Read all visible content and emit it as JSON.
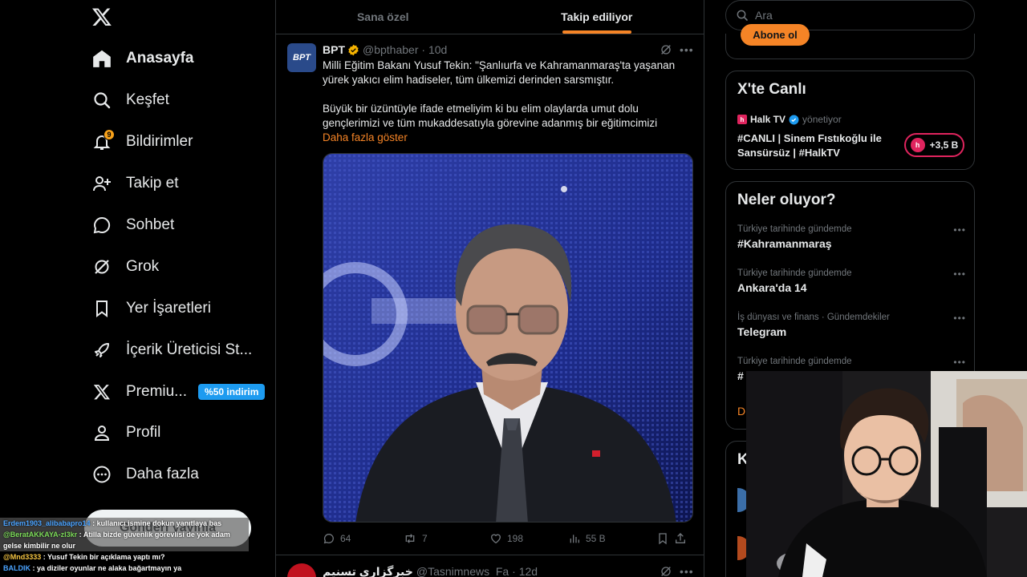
{
  "sidebar": {
    "items": [
      {
        "label": "Anasayfa",
        "icon": "home-icon"
      },
      {
        "label": "Keşfet",
        "icon": "search-icon"
      },
      {
        "label": "Bildirimler",
        "icon": "bell-icon",
        "badge": "9"
      },
      {
        "label": "Takip et",
        "icon": "follow-icon"
      },
      {
        "label": "Sohbet",
        "icon": "chat-icon"
      },
      {
        "label": "Grok",
        "icon": "grok-icon"
      },
      {
        "label": "Yer İşaretleri",
        "icon": "bookmark-icon"
      },
      {
        "label": "İçerik Üreticisi St...",
        "icon": "rocket-icon"
      },
      {
        "label": "Premiu...",
        "icon": "x-icon",
        "promo": "%50 indirim"
      },
      {
        "label": "Profil",
        "icon": "person-icon"
      },
      {
        "label": "Daha fazla",
        "icon": "more-circle-icon"
      }
    ],
    "post_button": "Gönderi yayınla"
  },
  "chat": [
    {
      "user": "Erdem1903_alibabapro14",
      "text": "kullanıcı ismine dokun yanıtlaya bas",
      "user_color": "#4aa3ff"
    },
    {
      "user": "@BeratAKKAYA-zl3kr",
      "text": "Atilla bizde güvenlik görevlisi de yok adam gelse kimbilir ne olur",
      "user_color": "#7ddc5a"
    },
    {
      "user": "@Mnd3333",
      "text": "Yusuf Tekin bir açıklama yaptı mı?",
      "user_color": "#f5c542"
    },
    {
      "user": "BALDIK",
      "text": "ya diziler oyunlar ne alaka bağartmayın ya",
      "user_color": "#4aa3ff"
    }
  ],
  "tabs": {
    "for_you": "Sana özel",
    "following": "Takip ediliyor"
  },
  "tweet": {
    "avatar_text": "BPT",
    "name": "BPT",
    "handle": "@bpthaber",
    "time": "10d",
    "para1": "Milli Eğitim Bakanı Yusuf Tekin: \"Şanlıurfa ve Kahramanmaraş'ta yaşanan yürek yakıcı elim hadiseler, tüm ülkemizi derinden sarsmıştır.",
    "para2": "Büyük bir üzüntüyle ifade etmeliyim ki bu elim olaylarda umut dolu gençlerimizi ve tüm mukaddesatıyla görevine adanmış bir eğitimcimizi",
    "show_more": "Daha fazla göster",
    "replies": "64",
    "reposts": "7",
    "likes": "198",
    "views": "55 B"
  },
  "tweet2": {
    "name": "خبرگزاری تسنیم",
    "handle": "@Tasnimnews_Fa",
    "time": "12d"
  },
  "right": {
    "search_placeholder": "Ara",
    "subscribe": "Abone ol",
    "live": {
      "title": "X'te Canlı",
      "host": "Halk TV",
      "host_suffix": "yönetiyor",
      "text": "#CANLI | Sinem Fıstıkoğlu ile Sansürsüz | #HalkTV",
      "count": "+3,5 B"
    },
    "trends_title": "Neler oluyor?",
    "trends": [
      {
        "context": "Türkiye tarihinde gündemde",
        "name": "#Kahramanmaraş"
      },
      {
        "context": "Türkiye tarihinde gündemde",
        "name": "Ankara'da 14"
      },
      {
        "context": "İş dünyası ve finans · Gündemdekiler",
        "name": "Telegram"
      },
      {
        "context": "Türkiye tarihinde gündemde",
        "name": "#"
      }
    ],
    "trends_show_more": "D",
    "who_title": "K"
  },
  "colors": {
    "accent": "#f58426",
    "verified": "#f5b301",
    "blue": "#1d9bf0"
  }
}
